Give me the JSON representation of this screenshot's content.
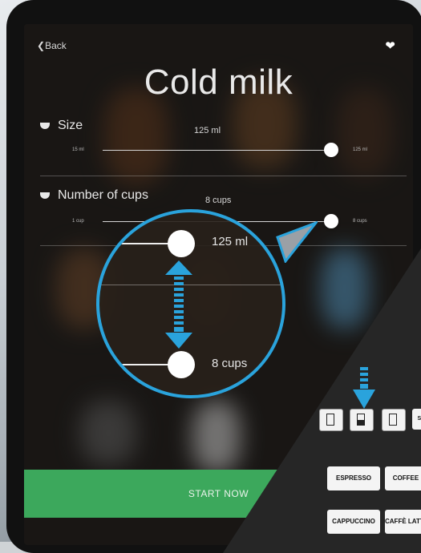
{
  "nav": {
    "back_label": "Back",
    "favorite_icon": "heart-icon"
  },
  "title": "Cold milk",
  "size": {
    "label": "Size",
    "value": "125 ml",
    "min": "15 ml",
    "max": "125 ml",
    "level": 1.0
  },
  "cups": {
    "label": "Number of cups",
    "value": "8 cups",
    "min": "1 cup",
    "max": "8 cups",
    "level": 1.0
  },
  "magnifier": {
    "size_value": "125 ml",
    "cups_value": "8 cups"
  },
  "start_label": "START NOW",
  "panel": {
    "cup_buttons": [
      {
        "name": "cup-small",
        "fill": 0.0
      },
      {
        "name": "cup-medium",
        "fill": 0.5
      },
      {
        "name": "cup-large",
        "fill": 0.0
      }
    ],
    "partial_label": "ST",
    "drinks": [
      "ESPRESSO",
      "COFFEE",
      "CAPPUCCINO",
      "CAFFÈ LATTE"
    ]
  },
  "colors": {
    "accent": "#2aa3dc",
    "start": "#3ca85c"
  }
}
